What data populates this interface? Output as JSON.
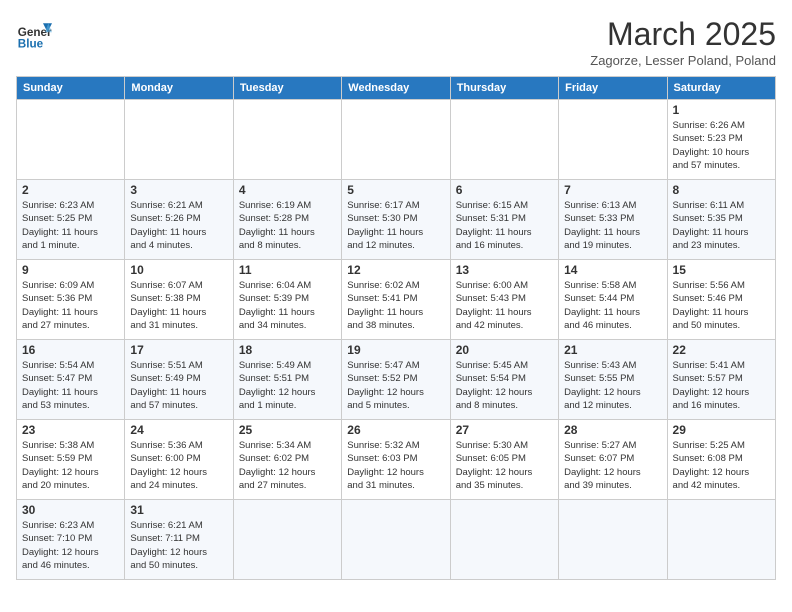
{
  "header": {
    "logo_general": "General",
    "logo_blue": "Blue",
    "month_title": "March 2025",
    "subtitle": "Zagorze, Lesser Poland, Poland"
  },
  "weekdays": [
    "Sunday",
    "Monday",
    "Tuesday",
    "Wednesday",
    "Thursday",
    "Friday",
    "Saturday"
  ],
  "weeks": [
    [
      {
        "day": "",
        "info": ""
      },
      {
        "day": "",
        "info": ""
      },
      {
        "day": "",
        "info": ""
      },
      {
        "day": "",
        "info": ""
      },
      {
        "day": "",
        "info": ""
      },
      {
        "day": "",
        "info": ""
      },
      {
        "day": "1",
        "info": "Sunrise: 6:26 AM\nSunset: 5:23 PM\nDaylight: 10 hours\nand 57 minutes."
      }
    ],
    [
      {
        "day": "2",
        "info": "Sunrise: 6:23 AM\nSunset: 5:25 PM\nDaylight: 11 hours\nand 1 minute."
      },
      {
        "day": "3",
        "info": "Sunrise: 6:21 AM\nSunset: 5:26 PM\nDaylight: 11 hours\nand 4 minutes."
      },
      {
        "day": "4",
        "info": "Sunrise: 6:19 AM\nSunset: 5:28 PM\nDaylight: 11 hours\nand 8 minutes."
      },
      {
        "day": "5",
        "info": "Sunrise: 6:17 AM\nSunset: 5:30 PM\nDaylight: 11 hours\nand 12 minutes."
      },
      {
        "day": "6",
        "info": "Sunrise: 6:15 AM\nSunset: 5:31 PM\nDaylight: 11 hours\nand 16 minutes."
      },
      {
        "day": "7",
        "info": "Sunrise: 6:13 AM\nSunset: 5:33 PM\nDaylight: 11 hours\nand 19 minutes."
      },
      {
        "day": "8",
        "info": "Sunrise: 6:11 AM\nSunset: 5:35 PM\nDaylight: 11 hours\nand 23 minutes."
      }
    ],
    [
      {
        "day": "9",
        "info": "Sunrise: 6:09 AM\nSunset: 5:36 PM\nDaylight: 11 hours\nand 27 minutes."
      },
      {
        "day": "10",
        "info": "Sunrise: 6:07 AM\nSunset: 5:38 PM\nDaylight: 11 hours\nand 31 minutes."
      },
      {
        "day": "11",
        "info": "Sunrise: 6:04 AM\nSunset: 5:39 PM\nDaylight: 11 hours\nand 34 minutes."
      },
      {
        "day": "12",
        "info": "Sunrise: 6:02 AM\nSunset: 5:41 PM\nDaylight: 11 hours\nand 38 minutes."
      },
      {
        "day": "13",
        "info": "Sunrise: 6:00 AM\nSunset: 5:43 PM\nDaylight: 11 hours\nand 42 minutes."
      },
      {
        "day": "14",
        "info": "Sunrise: 5:58 AM\nSunset: 5:44 PM\nDaylight: 11 hours\nand 46 minutes."
      },
      {
        "day": "15",
        "info": "Sunrise: 5:56 AM\nSunset: 5:46 PM\nDaylight: 11 hours\nand 50 minutes."
      }
    ],
    [
      {
        "day": "16",
        "info": "Sunrise: 5:54 AM\nSunset: 5:47 PM\nDaylight: 11 hours\nand 53 minutes."
      },
      {
        "day": "17",
        "info": "Sunrise: 5:51 AM\nSunset: 5:49 PM\nDaylight: 11 hours\nand 57 minutes."
      },
      {
        "day": "18",
        "info": "Sunrise: 5:49 AM\nSunset: 5:51 PM\nDaylight: 12 hours\nand 1 minute."
      },
      {
        "day": "19",
        "info": "Sunrise: 5:47 AM\nSunset: 5:52 PM\nDaylight: 12 hours\nand 5 minutes."
      },
      {
        "day": "20",
        "info": "Sunrise: 5:45 AM\nSunset: 5:54 PM\nDaylight: 12 hours\nand 8 minutes."
      },
      {
        "day": "21",
        "info": "Sunrise: 5:43 AM\nSunset: 5:55 PM\nDaylight: 12 hours\nand 12 minutes."
      },
      {
        "day": "22",
        "info": "Sunrise: 5:41 AM\nSunset: 5:57 PM\nDaylight: 12 hours\nand 16 minutes."
      }
    ],
    [
      {
        "day": "23",
        "info": "Sunrise: 5:38 AM\nSunset: 5:59 PM\nDaylight: 12 hours\nand 20 minutes."
      },
      {
        "day": "24",
        "info": "Sunrise: 5:36 AM\nSunset: 6:00 PM\nDaylight: 12 hours\nand 24 minutes."
      },
      {
        "day": "25",
        "info": "Sunrise: 5:34 AM\nSunset: 6:02 PM\nDaylight: 12 hours\nand 27 minutes."
      },
      {
        "day": "26",
        "info": "Sunrise: 5:32 AM\nSunset: 6:03 PM\nDaylight: 12 hours\nand 31 minutes."
      },
      {
        "day": "27",
        "info": "Sunrise: 5:30 AM\nSunset: 6:05 PM\nDaylight: 12 hours\nand 35 minutes."
      },
      {
        "day": "28",
        "info": "Sunrise: 5:27 AM\nSunset: 6:07 PM\nDaylight: 12 hours\nand 39 minutes."
      },
      {
        "day": "29",
        "info": "Sunrise: 5:25 AM\nSunset: 6:08 PM\nDaylight: 12 hours\nand 42 minutes."
      }
    ],
    [
      {
        "day": "30",
        "info": "Sunrise: 6:23 AM\nSunset: 7:10 PM\nDaylight: 12 hours\nand 46 minutes."
      },
      {
        "day": "31",
        "info": "Sunrise: 6:21 AM\nSunset: 7:11 PM\nDaylight: 12 hours\nand 50 minutes."
      },
      {
        "day": "",
        "info": ""
      },
      {
        "day": "",
        "info": ""
      },
      {
        "day": "",
        "info": ""
      },
      {
        "day": "",
        "info": ""
      },
      {
        "day": "",
        "info": ""
      }
    ]
  ]
}
